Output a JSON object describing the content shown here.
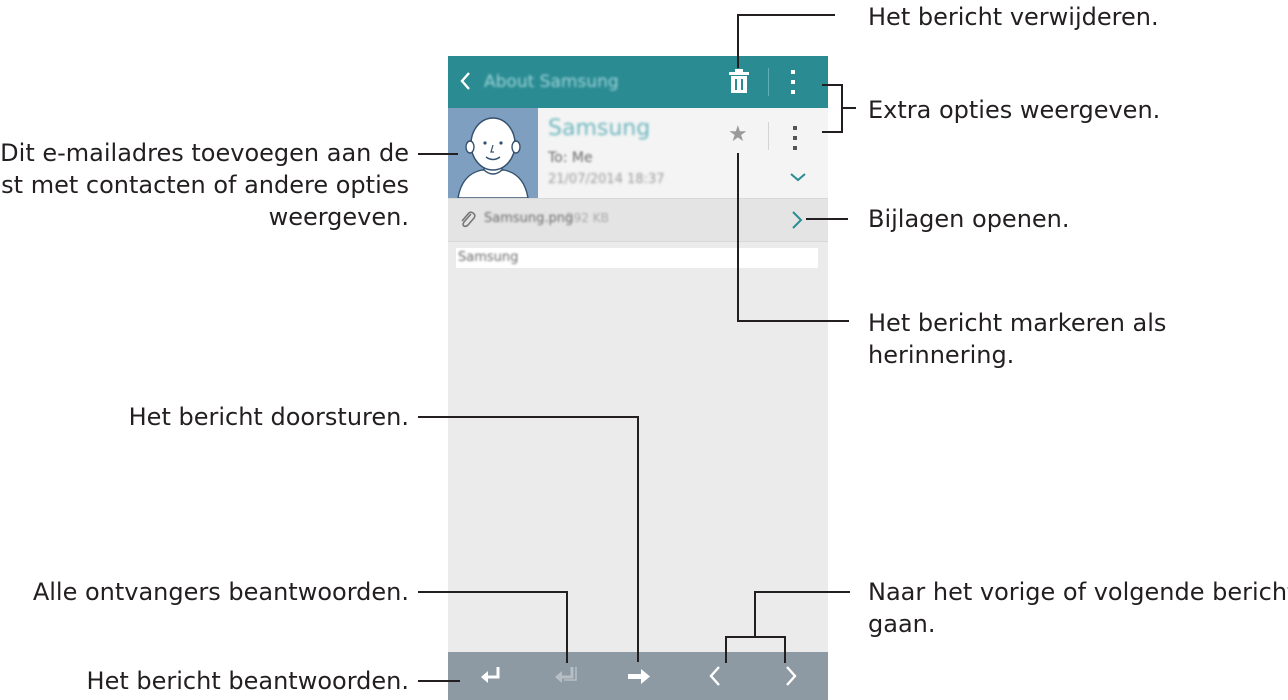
{
  "annotations": {
    "delete": "Het bericht verwijderen.",
    "more_options": "Extra opties weergeven.",
    "contact_line1": "Dit e-mailadres toevoegen aan de",
    "contact_line2": "lijst met contacten of andere opties",
    "contact_line3": "weergeven.",
    "attachments": "Bijlagen openen.",
    "mark_line1": "Het bericht markeren als",
    "mark_line2": "herinnering.",
    "forward": "Het bericht doorsturen.",
    "reply_all": "Alle ontvangers beantwoorden.",
    "reply": "Het bericht beantwoorden.",
    "prev_next_line1": "Naar het vorige of volgende bericht",
    "prev_next_line2": "gaan."
  },
  "app_bar": {
    "title": "About Samsung",
    "icons": [
      "back-icon",
      "trash-icon",
      "more-vertical-icon"
    ]
  },
  "message": {
    "sender": "Samsung",
    "to": "To: Me",
    "date": "21/07/2014 18:37",
    "icons": [
      "avatar",
      "star-icon",
      "more-vertical-icon",
      "chevron-down-icon"
    ]
  },
  "attachment": {
    "file_name": "Samsung.png",
    "file_size": "592 KB",
    "icons": [
      "paperclip-icon",
      "chevron-right-icon"
    ]
  },
  "body_text": "Samsung",
  "bottom_bar": {
    "icons": [
      "reply-icon",
      "reply-all-icon",
      "forward-icon",
      "previous-icon",
      "next-icon"
    ]
  },
  "colors": {
    "app_bar": "#2a8b93",
    "bottom_bar": "#8e9aa3",
    "avatar_bg": "#7f9fc0",
    "sender_name": "#6db7bf",
    "page_bg": "#ebebeb"
  }
}
